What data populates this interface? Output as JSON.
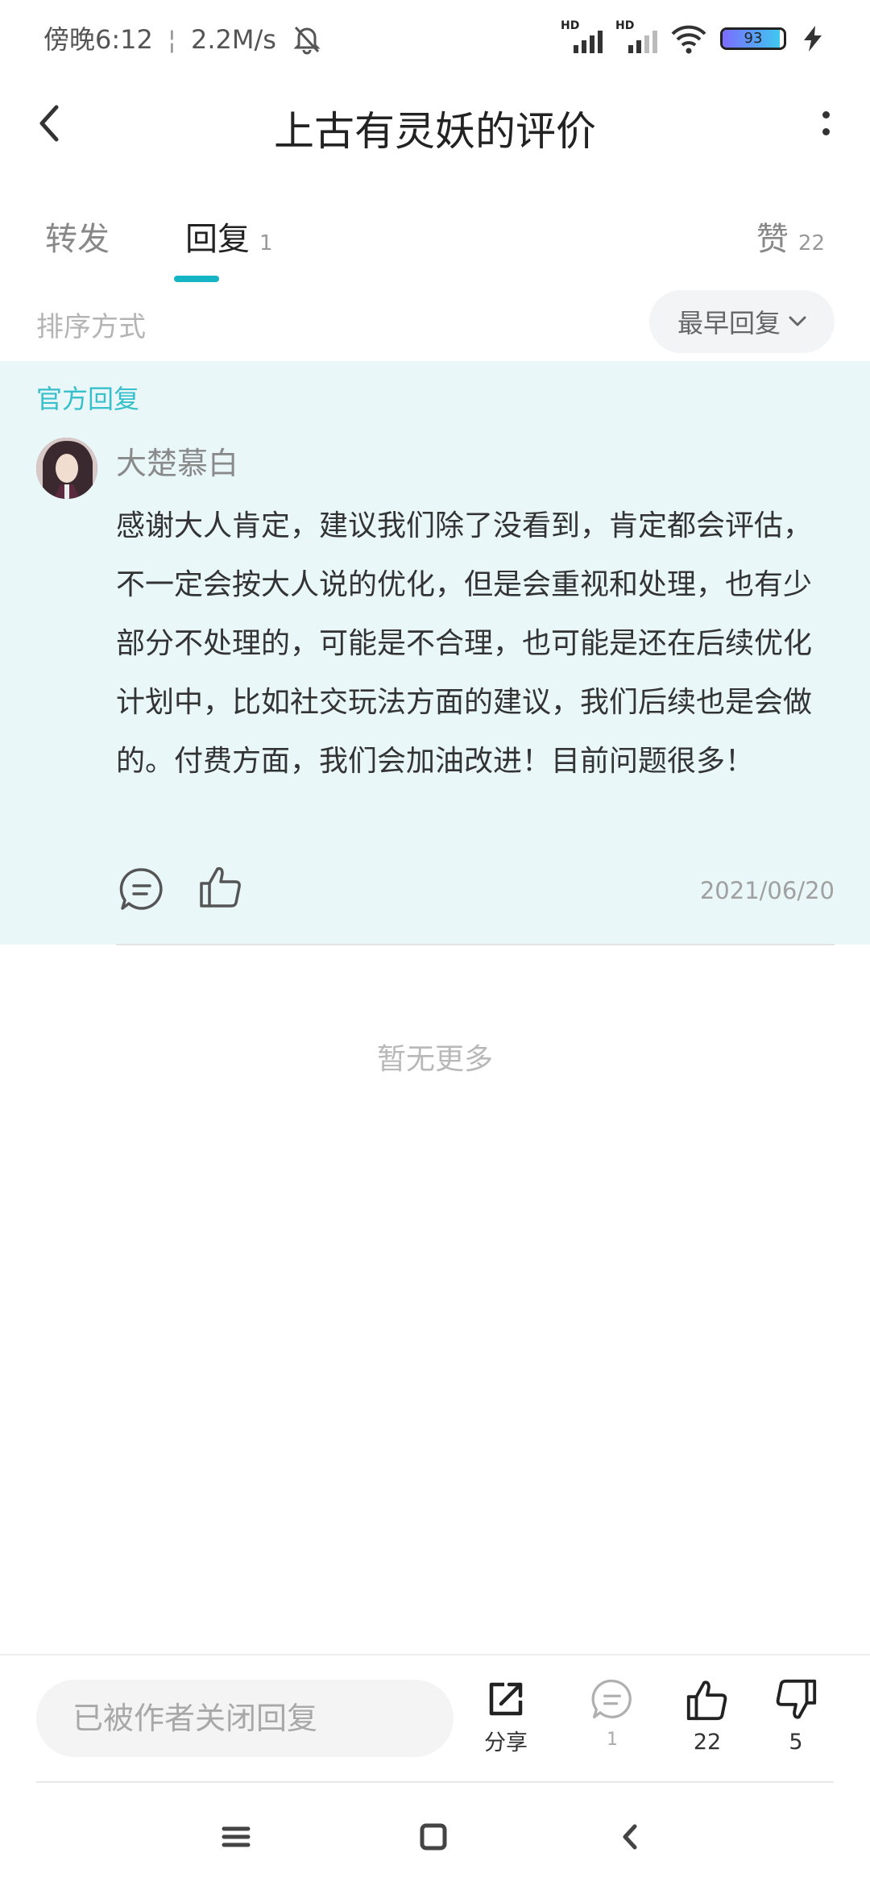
{
  "status_bar": {
    "time": "傍晚6:12",
    "speed": "2.2M/s",
    "battery_level": "93",
    "signal_labels": [
      "HD",
      "HD"
    ]
  },
  "title_bar": {
    "title": "上古有灵妖的评价"
  },
  "tabs": [
    {
      "label": "转发",
      "count": ""
    },
    {
      "label": "回复",
      "count": "1"
    },
    {
      "label": "赞",
      "count": "22"
    }
  ],
  "sort": {
    "label": "排序方式",
    "selected": "最早回复"
  },
  "reply": {
    "official_label": "官方回复",
    "author": "大楚慕白",
    "body": "感谢大人肯定，建议我们除了没看到，肯定都会评估，不一定会按大人说的优化，但是会重视和处理，也有少部分不处理的，可能是不合理，也可能是还在后续优化计划中，比如社交玩法方面的建议，我们后续也是会做的。付费方面，我们会加油改进！目前问题很多！",
    "date": "2021/06/20"
  },
  "no_more_text": "暂无更多",
  "bottom_bar": {
    "input_placeholder": "已被作者关闭回复",
    "share_label": "分享",
    "reply_count": "1",
    "like_count": "22",
    "dislike_count": "5"
  },
  "colors": {
    "accent": "#15b5c6",
    "official_bg": "#e9f7f8",
    "official_text": "#37bfcc"
  }
}
